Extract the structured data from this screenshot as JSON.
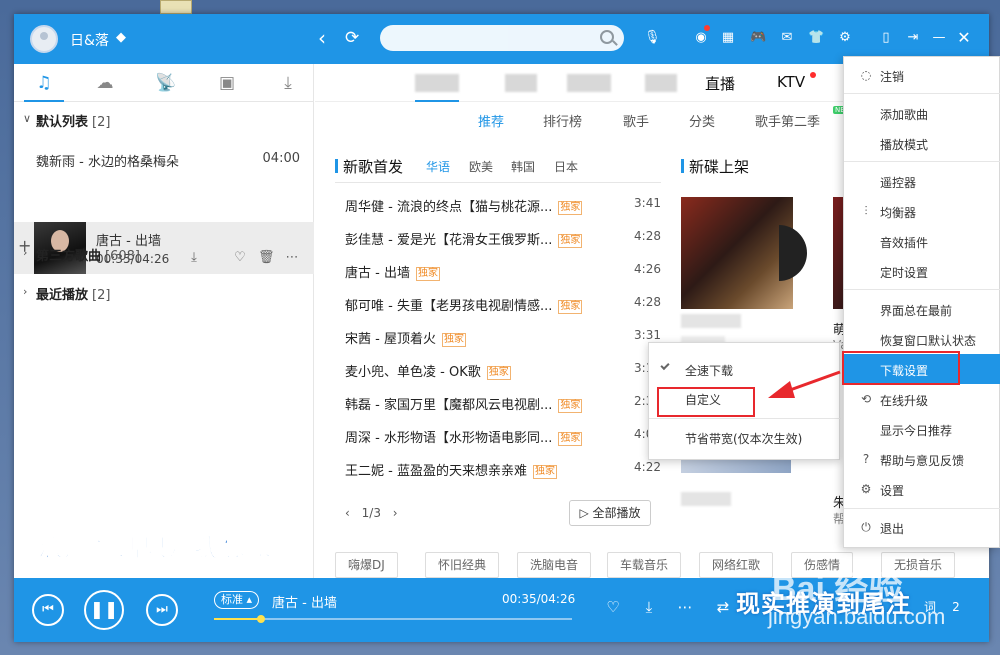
{
  "titlebar": {
    "username": "日&落"
  },
  "left": {
    "default_list": {
      "name": "默认列表",
      "count": "[2]"
    },
    "songs": [
      {
        "title": "魏新雨 - 水边的格桑梅朵",
        "duration": "04:00"
      }
    ],
    "now_playing": {
      "title": "唐古 - 出墙",
      "time": "00:35/04:26"
    },
    "third_party": {
      "name": "第三方歌曲",
      "count": "[608]"
    },
    "recent": {
      "name": "最近播放",
      "count": "[2]"
    }
  },
  "top_tabs": {
    "live": "直播",
    "ktv": "KTV"
  },
  "sub_tabs": [
    "推荐",
    "排行榜",
    "歌手",
    "分类",
    "歌手第二季"
  ],
  "new_badge": "NEW",
  "new_songs": {
    "title": "新歌首发",
    "langs": [
      "华语",
      "欧美",
      "韩国",
      "日本"
    ],
    "items": [
      {
        "title": "周华健 - 流浪的终点【猫与桃花源...",
        "tag": "独家",
        "duration": "3:41"
      },
      {
        "title": "彭佳慧 - 爱是光【花滑女王俄罗斯...",
        "tag": "独家",
        "duration": "4:28"
      },
      {
        "title": "唐古 - 出墙",
        "tag": "独家",
        "duration": "4:26"
      },
      {
        "title": "郁可唯 - 失重【老男孩电视剧情感...",
        "tag": "独家",
        "duration": "4:28"
      },
      {
        "title": "宋茜 - 屋顶着火",
        "tag": "独家",
        "duration": "3:31"
      },
      {
        "title": "麦小兜、单色凌 - OK歌",
        "tag": "独家",
        "duration": "3:15"
      },
      {
        "title": "韩磊 - 家国万里【魔都风云电视剧...",
        "tag": "独家",
        "duration": "2:35"
      },
      {
        "title": "周深 - 水形物语【水形物语电影同...",
        "tag": "独家",
        "duration": "4:08"
      },
      {
        "title": "王二妮 - 蓝盈盈的天来想亲亲难",
        "tag": "独家",
        "duration": "4:22"
      }
    ],
    "pager": "1/3",
    "play_all": "全部播放"
  },
  "new_albums": {
    "title": "新碟上架",
    "partial_text": "萌",
    "partial_text2": "Va",
    "partial_text3": "朱",
    "partial_text4": "帮"
  },
  "genres": [
    "嗨爆DJ",
    "怀旧经典",
    "洗脑电音",
    "车载音乐",
    "网络红歌",
    "伤感情",
    "无损音乐"
  ],
  "player": {
    "quality": "标准",
    "title": "唐古 - 出墙",
    "time": "00:35/04:26",
    "progress": 0.13,
    "extra": "词",
    "extra2": "2"
  },
  "popup": {
    "items": [
      "全速下载",
      "自定义",
      "节省带宽(仅本次生效)"
    ]
  },
  "menu": {
    "items": [
      "注销",
      "添加歌曲",
      "播放模式",
      "遥控器",
      "均衡器",
      "音效插件",
      "定时设置",
      "界面总在最前",
      "恢复窗口默认状态",
      "下载设置",
      "在线升级",
      "显示今日推荐",
      "帮助与意见反馈",
      "设置",
      "退出"
    ]
  },
  "overlay": {
    "lyric": "浪漫童话只是我想象",
    "lyric2": "现实推演到尾注",
    "watermark": "Bai 经验",
    "watermark_url": "jingyan.baidu.com"
  },
  "colors": {
    "accent": "#1f95e6",
    "highlight_box": "#e8282d",
    "tag": "#f08a24"
  }
}
